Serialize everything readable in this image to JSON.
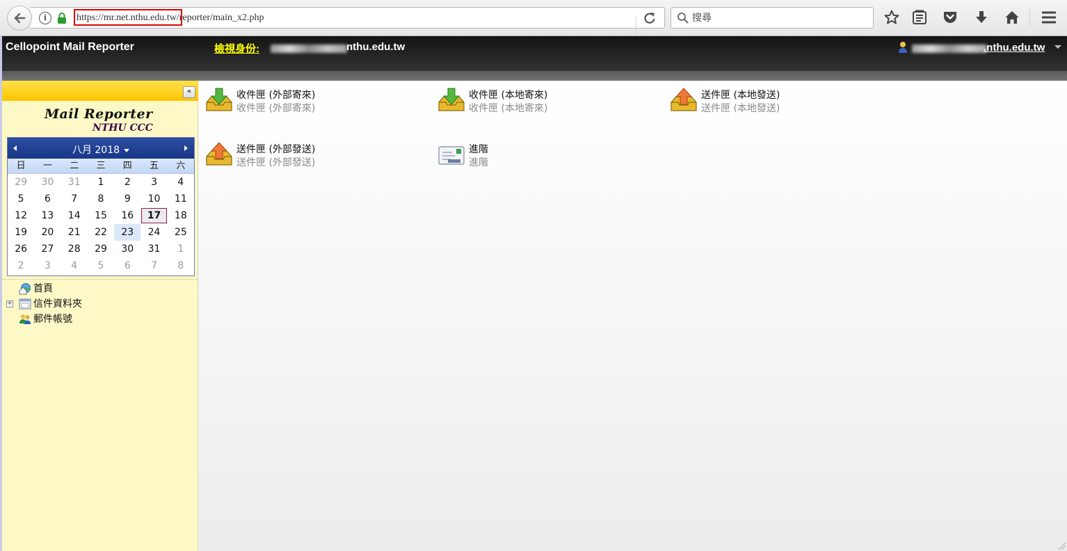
{
  "browser": {
    "url": "https://mr.net.nthu.edu.tw/reporter/main_x2.php",
    "search_placeholder": "搜尋",
    "icons": [
      "back-arrow-icon",
      "info-icon",
      "lock-icon",
      "reload-icon",
      "search-icon",
      "bookmark-star-icon",
      "reading-list-icon",
      "pocket-icon",
      "download-icon",
      "home-icon",
      "menu-icon"
    ]
  },
  "header": {
    "title": "Cellopoint Mail Reporter",
    "identity_label": "檢視身份:",
    "identity_domain": "nthu.edu.tw",
    "user_domain": ".nthu.edu.tw"
  },
  "sidebar": {
    "logo_main": "Mail Reporter",
    "logo_sub": "NTHU CCC",
    "calendar": {
      "title": "八月 2018",
      "weekdays": [
        "日",
        "一",
        "二",
        "三",
        "四",
        "五",
        "六"
      ],
      "weeks": [
        [
          "29",
          "30",
          "31",
          "1",
          "2",
          "3",
          "4"
        ],
        [
          "5",
          "6",
          "7",
          "8",
          "9",
          "10",
          "11"
        ],
        [
          "12",
          "13",
          "14",
          "15",
          "16",
          "17",
          "18"
        ],
        [
          "19",
          "20",
          "21",
          "22",
          "23",
          "24",
          "25"
        ],
        [
          "26",
          "27",
          "28",
          "29",
          "30",
          "31",
          "1"
        ],
        [
          "2",
          "3",
          "4",
          "5",
          "6",
          "7",
          "8"
        ]
      ],
      "today": "17",
      "selected": "23"
    },
    "tree": [
      {
        "label": "首頁",
        "icon": "home-globe-icon",
        "expandable": false
      },
      {
        "label": "信件資料夾",
        "icon": "mail-folder-icon",
        "expandable": true
      },
      {
        "label": "郵件帳號",
        "icon": "users-icon",
        "expandable": false
      }
    ]
  },
  "main": {
    "tiles": [
      {
        "title": "收件匣 (外部寄來)",
        "subtitle": "收件匣 (外部寄來)",
        "icon": "inbox-download-icon"
      },
      {
        "title": "收件匣 (本地寄來)",
        "subtitle": "收件匣 (本地寄來)",
        "icon": "inbox-download-icon"
      },
      {
        "title": "送件匣 (本地發送)",
        "subtitle": "送件匣 (本地發送)",
        "icon": "outbox-upload-icon"
      },
      {
        "title": "送件匣 (外部發送)",
        "subtitle": "送件匣 (外部發送)",
        "icon": "outbox-upload-icon"
      },
      {
        "title": "進階",
        "subtitle": "進階",
        "icon": "envelope-icon"
      }
    ]
  },
  "colors": {
    "header_bg": "#262626",
    "identity_label": "#ffff00",
    "sidebar_bg": "#fcf9c7",
    "sidebar_topbar": "#fcc400",
    "calendar_header": "#1a3787",
    "url_highlight": "#e00000"
  }
}
